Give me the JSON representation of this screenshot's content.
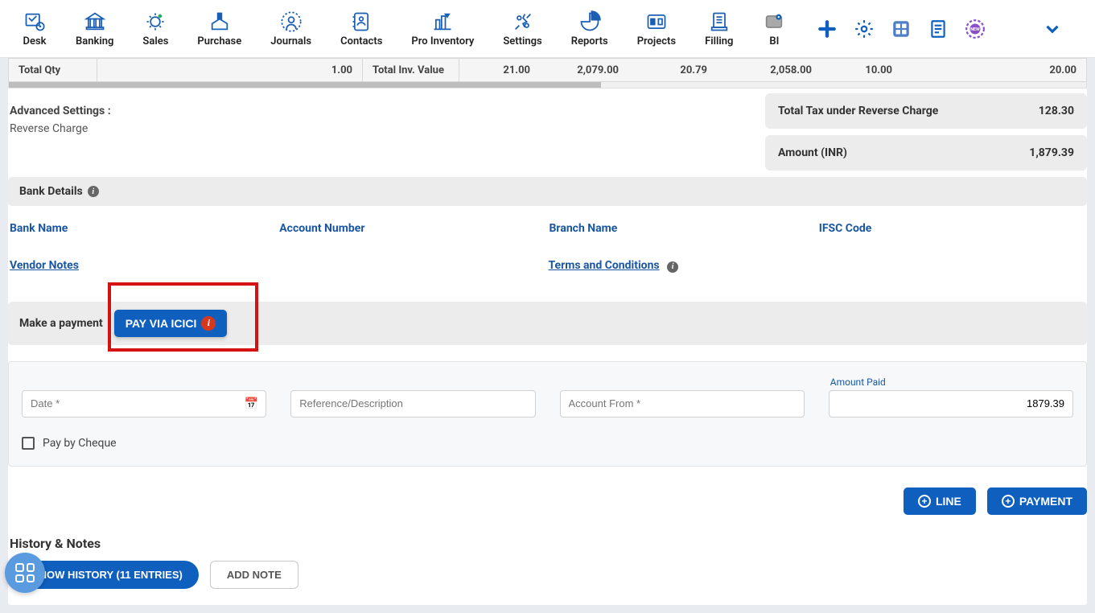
{
  "nav": {
    "items": [
      {
        "label": "Desk"
      },
      {
        "label": "Banking"
      },
      {
        "label": "Sales"
      },
      {
        "label": "Purchase"
      },
      {
        "label": "Journals"
      },
      {
        "label": "Contacts"
      },
      {
        "label": "Pro Inventory"
      },
      {
        "label": "Settings"
      },
      {
        "label": "Reports"
      },
      {
        "label": "Projects"
      },
      {
        "label": "Filling"
      },
      {
        "label": "BI"
      }
    ]
  },
  "totals": {
    "total_qty_label": "Total Qty",
    "total_qty": "1.00",
    "total_inv_label": "Total Inv. Value",
    "v1": "21.00",
    "v2": "2,079.00",
    "v3": "20.79",
    "v4": "2,058.00",
    "v5": "10.00",
    "v6": "20.00"
  },
  "advanced": {
    "title": "Advanced Settings :",
    "item": "Reverse Charge"
  },
  "summary": {
    "tax_label": "Total Tax under Reverse Charge",
    "tax_value": "128.30",
    "amount_label": "Amount (INR)",
    "amount_value": "1,879.39"
  },
  "bank": {
    "section_title": "Bank Details",
    "bank_name": "Bank Name",
    "account_number": "Account Number",
    "branch_name": "Branch Name",
    "ifsc_code": "IFSC Code"
  },
  "links": {
    "vendor_notes": "Vendor Notes",
    "terms": "Terms and Conditions"
  },
  "payment": {
    "title": "Make a payment",
    "pay_icici": "PAY VIA ICICI",
    "date_placeholder": "Date *",
    "ref_placeholder": "Reference/Description",
    "account_placeholder": "Account From *",
    "amount_paid_label": "Amount Paid",
    "amount_paid_value": "1879.39",
    "pay_by_cheque": "Pay by Cheque"
  },
  "buttons": {
    "line": "LINE",
    "payment": "PAYMENT"
  },
  "history": {
    "title": "History & Notes",
    "show_history": "SHOW HISTORY (11 ENTRIES)",
    "add_note": "ADD NOTE"
  }
}
